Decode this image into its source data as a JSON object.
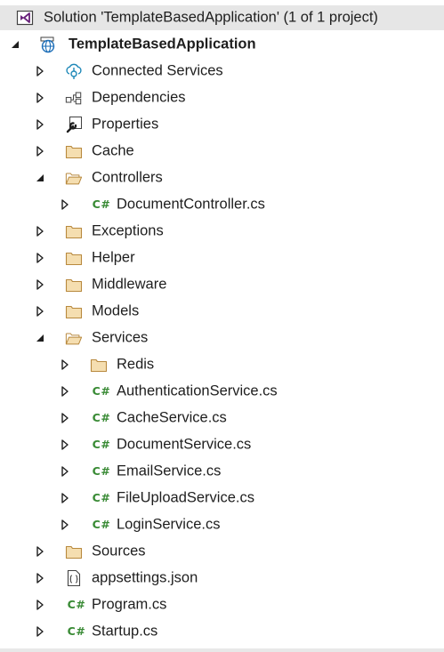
{
  "solution": {
    "label": "Solution 'TemplateBasedApplication' (1 of 1 project)",
    "icon": "visual-studio-solution-icon"
  },
  "project": {
    "label": "TemplateBasedApplication",
    "icon": "web-project-globe-icon",
    "expanded": true
  },
  "items": [
    {
      "label": "Connected Services",
      "icon": "connected-services-icon",
      "expanded": false
    },
    {
      "label": "Dependencies",
      "icon": "dependencies-icon",
      "expanded": false
    },
    {
      "label": "Properties",
      "icon": "properties-wrench-icon",
      "expanded": false
    },
    {
      "label": "Cache",
      "icon": "folder-icon",
      "expanded": false
    },
    {
      "label": "Controllers",
      "icon": "folder-open-icon",
      "expanded": true
    },
    {
      "label": "DocumentController.cs",
      "icon": "csharp-file-icon",
      "expanded": false
    },
    {
      "label": "Exceptions",
      "icon": "folder-icon",
      "expanded": false
    },
    {
      "label": "Helper",
      "icon": "folder-icon",
      "expanded": false
    },
    {
      "label": "Middleware",
      "icon": "folder-icon",
      "expanded": false
    },
    {
      "label": "Models",
      "icon": "folder-icon",
      "expanded": false
    },
    {
      "label": "Services",
      "icon": "folder-open-icon",
      "expanded": true
    },
    {
      "label": "Redis",
      "icon": "folder-icon",
      "expanded": false
    },
    {
      "label": "AuthenticationService.cs",
      "icon": "csharp-file-icon",
      "expanded": false
    },
    {
      "label": "CacheService.cs",
      "icon": "csharp-file-icon",
      "expanded": false
    },
    {
      "label": "DocumentService.cs",
      "icon": "csharp-file-icon",
      "expanded": false
    },
    {
      "label": "EmailService.cs",
      "icon": "csharp-file-icon",
      "expanded": false
    },
    {
      "label": "FileUploadService.cs",
      "icon": "csharp-file-icon",
      "expanded": false
    },
    {
      "label": "LoginService.cs",
      "icon": "csharp-file-icon",
      "expanded": false
    },
    {
      "label": "Sources",
      "icon": "folder-icon",
      "expanded": false
    },
    {
      "label": "appsettings.json",
      "icon": "json-file-icon",
      "expanded": false
    },
    {
      "label": "Program.cs",
      "icon": "csharp-file-icon",
      "expanded": false
    },
    {
      "label": "Startup.cs",
      "icon": "csharp-file-icon",
      "expanded": false
    }
  ],
  "csharp_glyph": "C#",
  "json_glyph": "{ }",
  "colors": {
    "folder_fill": "#dcb67a",
    "folder_stroke": "#b8893e",
    "csharp_green": "#388a34",
    "vs_purple": "#68217a",
    "globe_blue": "#1e6fb8",
    "selected_bg": "#e6e6e6",
    "text": "#1e1e1e"
  }
}
